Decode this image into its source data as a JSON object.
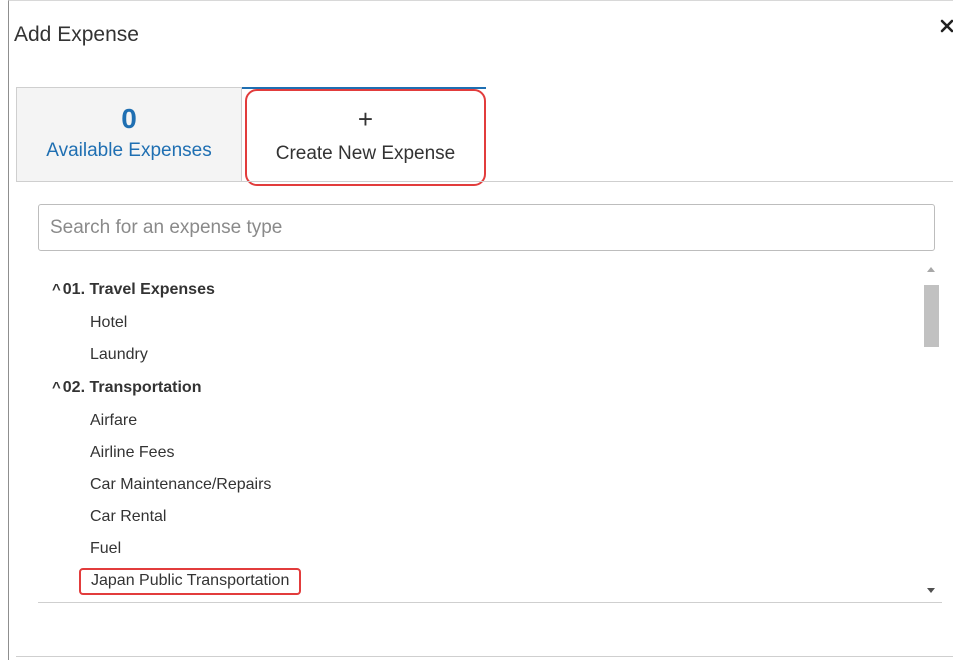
{
  "dialog": {
    "title": "Add Expense",
    "close_icon": "close-icon"
  },
  "tabs": {
    "available": {
      "count": "0",
      "label": "Available Expenses"
    },
    "create": {
      "icon": "+",
      "label": "Create New Expense"
    }
  },
  "search": {
    "placeholder": "Search for an expense type",
    "value": ""
  },
  "expense_types": {
    "group_1": {
      "caret": "^",
      "label": "01. Travel Expenses",
      "items": [
        "Hotel",
        "Laundry"
      ]
    },
    "group_2": {
      "caret": "^",
      "label": "02. Transportation",
      "items": [
        "Airfare",
        "Airline Fees",
        "Car Maintenance/Repairs",
        "Car Rental",
        "Fuel",
        "Japan Public Transportation"
      ]
    }
  },
  "colors": {
    "accent": "#1f6fb2",
    "highlight": "#e23c3c"
  }
}
